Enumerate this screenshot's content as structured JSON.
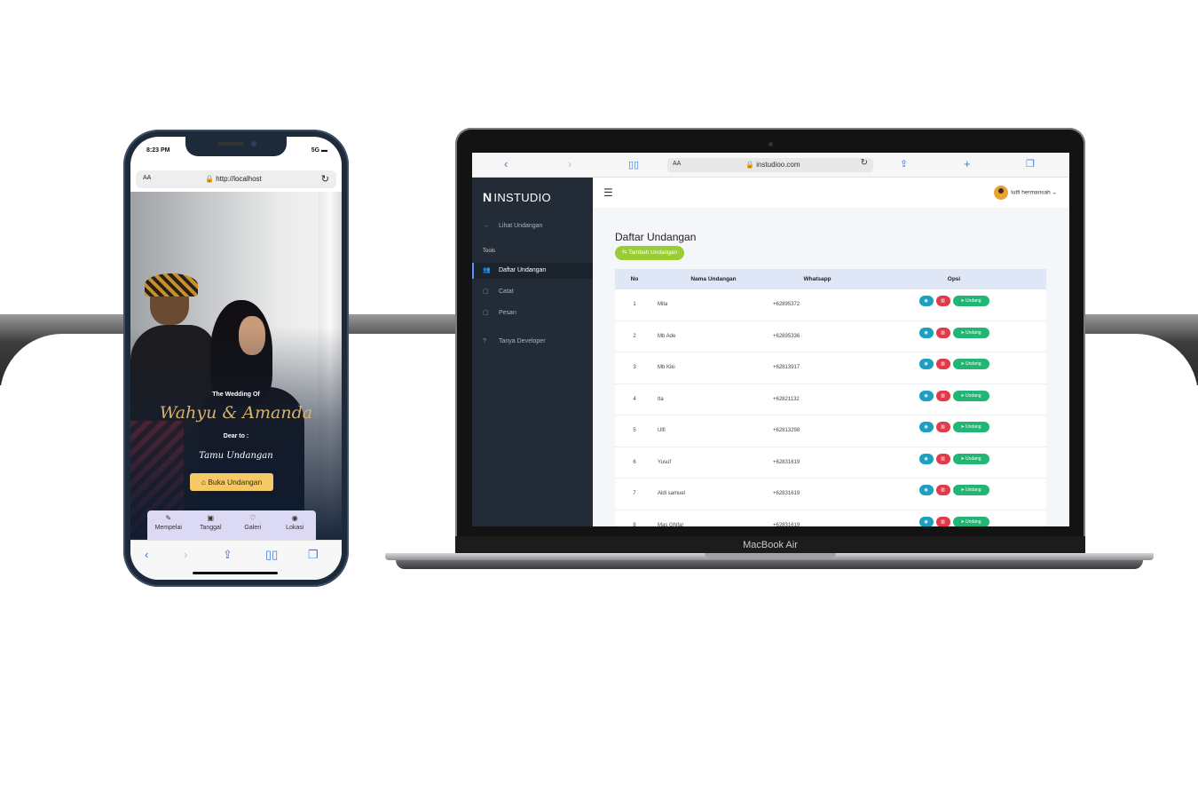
{
  "phone": {
    "status": {
      "time": "8:23 PM",
      "signal": "5G"
    },
    "browser": {
      "aa": "AA",
      "url": "http://localhost"
    },
    "invitation": {
      "wedding_of": "The Wedding Of",
      "couple": "Wahyu & Amanda",
      "dear_to": "Dear to :",
      "guest": "Tamu Undangan",
      "open_button": "Buka Undangan"
    },
    "nav": [
      {
        "label": "Mempelai",
        "icon": "rings-icon"
      },
      {
        "label": "Tanggal",
        "icon": "calendar-icon"
      },
      {
        "label": "Galeri",
        "icon": "gallery-icon"
      },
      {
        "label": "Lokasi",
        "icon": "location-icon"
      }
    ]
  },
  "laptop": {
    "model": "MacBook Air",
    "browser": {
      "aa": "AA",
      "url": "instudioo.com"
    },
    "app": {
      "brand": "INSTUDIO",
      "brand_logo": "N",
      "sidebar": {
        "view_invitation": "Lihat Undangan",
        "section_tools": "Tools",
        "items": [
          {
            "label": "Daftar Undangan",
            "icon": "users-icon",
            "active": true
          },
          {
            "label": "Catat",
            "icon": "note-icon",
            "active": false
          },
          {
            "label": "Pesan",
            "icon": "message-icon",
            "active": false
          },
          {
            "label": "Tanya Developer",
            "icon": "question-icon",
            "active": false
          }
        ]
      },
      "user": {
        "name": "lutfi hermansah"
      },
      "page_title": "Daftar Undangan",
      "add_button": "Tambah Undangan",
      "table": {
        "headers": [
          "No",
          "Nama Undangan",
          "Whatsapp",
          "Opsi"
        ],
        "action_send": "Undang",
        "rows": [
          {
            "no": "1",
            "name": "Mita",
            "wa": "+62895372"
          },
          {
            "no": "2",
            "name": "Mb Ade",
            "wa": "+62895336"
          },
          {
            "no": "3",
            "name": "Mb Kiki",
            "wa": "+62813917"
          },
          {
            "no": "4",
            "name": "Ita",
            "wa": "+62821132"
          },
          {
            "no": "5",
            "name": "Ulfi",
            "wa": "+62813298"
          },
          {
            "no": "6",
            "name": "Yusuf",
            "wa": "+62831619"
          },
          {
            "no": "7",
            "name": "Aldi samuel",
            "wa": "+62831619"
          },
          {
            "no": "8",
            "name": "Mas Ghifar",
            "wa": "+62831619"
          }
        ]
      }
    }
  }
}
